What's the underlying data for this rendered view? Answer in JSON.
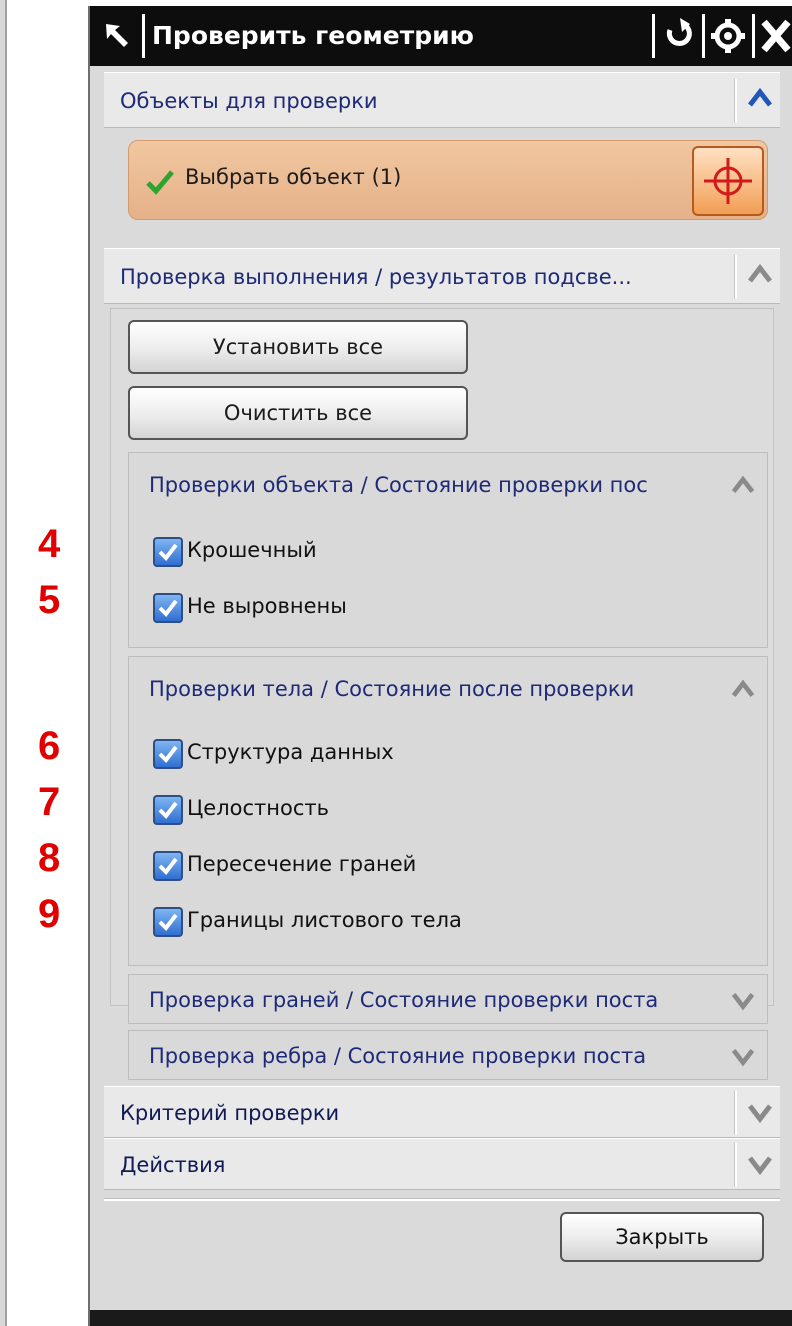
{
  "window": {
    "title": "Проверить геометрию",
    "icons": [
      "pin-icon",
      "reset-icon",
      "gear-icon",
      "close-icon"
    ]
  },
  "sections": {
    "objects": {
      "label": "Объекты для проверки",
      "expanded": true
    },
    "select": {
      "label": "Выбрать объект (1)",
      "icon": "crosshair-icon"
    },
    "check_perf": {
      "label": "Проверка выполнения / результатов подсве...",
      "expanded": true
    },
    "buttons": {
      "set_all": "Установить все",
      "clear_all": "Очистить все"
    },
    "object_checks": {
      "label": "Проверки объекта / Состояние проверки пос",
      "items": [
        {
          "label": "Крошечный",
          "checked": true,
          "number": "4"
        },
        {
          "label": "Не выровнены",
          "checked": true,
          "number": "5"
        }
      ]
    },
    "body_checks": {
      "label": "Проверки тела / Состояние после проверки",
      "items": [
        {
          "label": "Структура данных",
          "checked": true,
          "number": "6"
        },
        {
          "label": "Целостность",
          "checked": true,
          "number": "7"
        },
        {
          "label": "Пересечение граней",
          "checked": true,
          "number": "8"
        },
        {
          "label": "Границы листового тела",
          "checked": true,
          "number": "9"
        }
      ]
    },
    "face_checks": {
      "label": "Проверка граней / Состояние проверки поста",
      "expanded": false
    },
    "edge_checks": {
      "label": "Проверка ребра / Состояние проверки поста",
      "expanded": false
    },
    "criteria": {
      "label": "Критерий проверки",
      "expanded": false
    },
    "actions": {
      "label": "Действия",
      "expanded": false
    }
  },
  "footer": {
    "close_label": "Закрыть"
  },
  "colors": {
    "accent_orange": "#f29e54",
    "title_bg": "#0d0d0d",
    "annotation_red": "#e00000"
  }
}
